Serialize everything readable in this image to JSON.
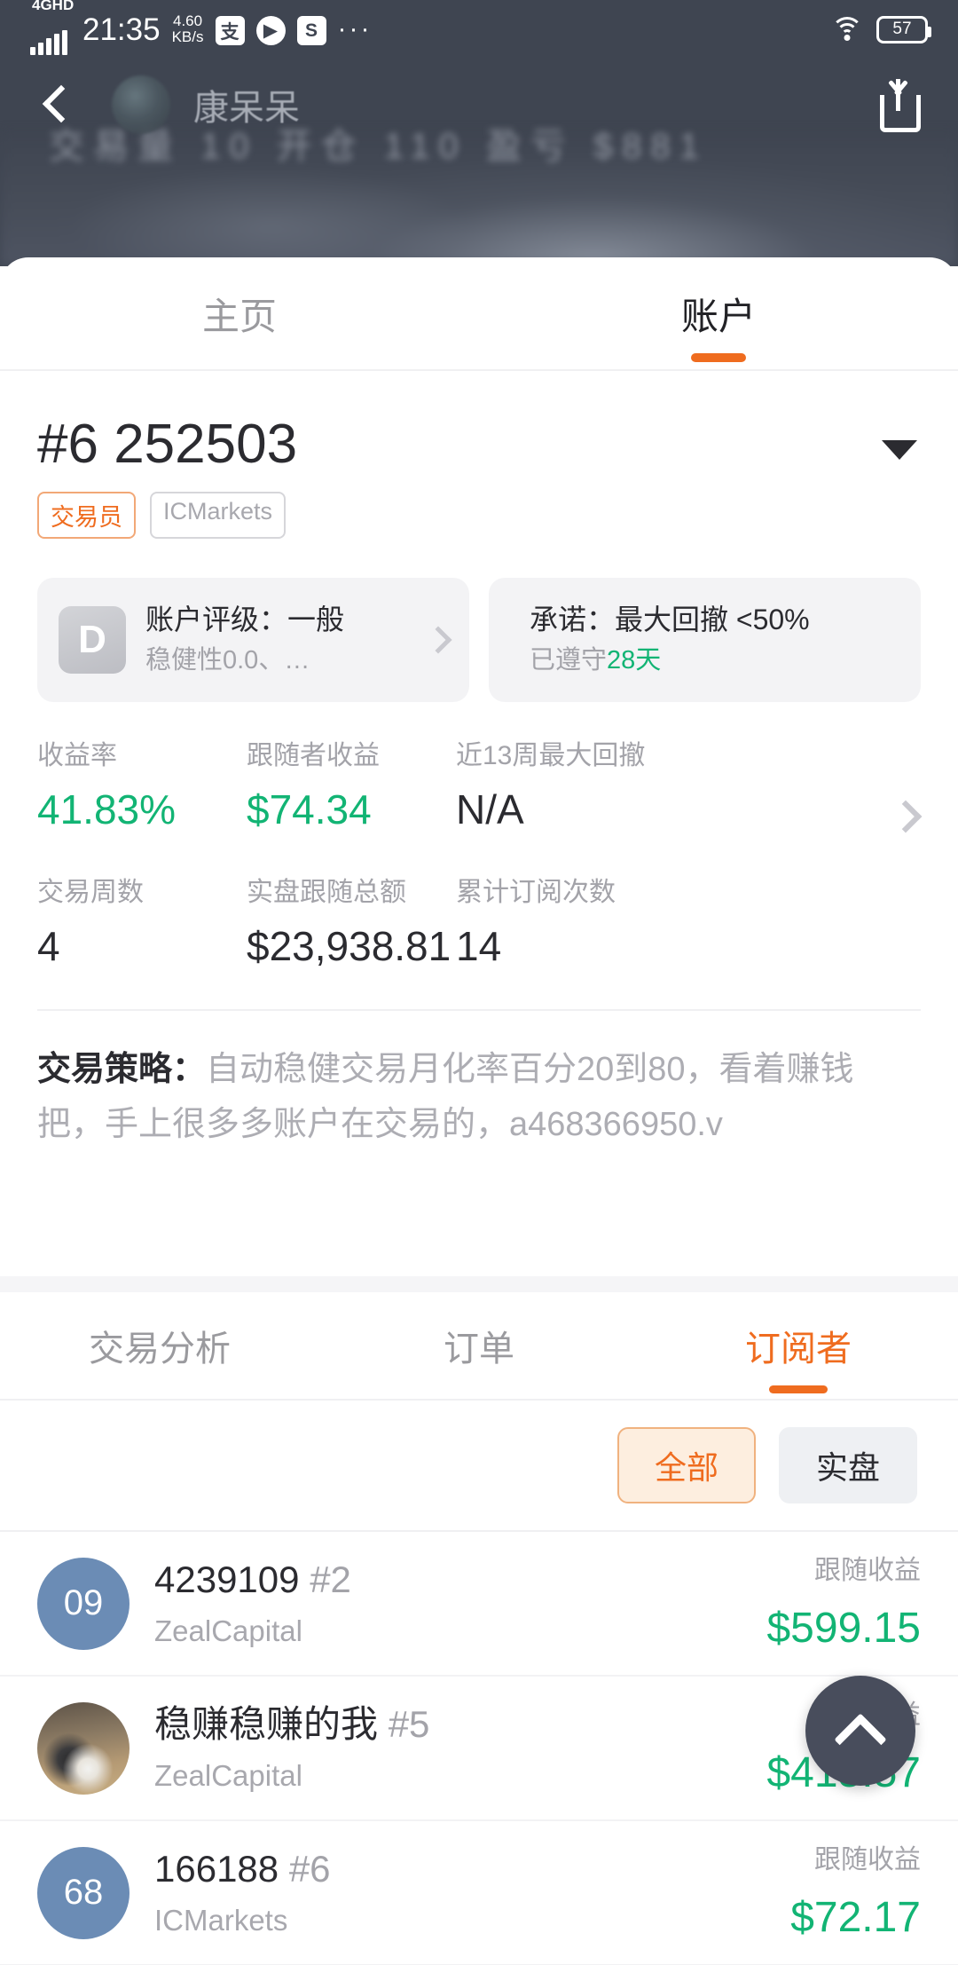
{
  "status_bar": {
    "network": "4GHD",
    "time": "21:35",
    "speed_value": "4.60",
    "speed_unit": "KB/s",
    "app_icon_1": "alipay-icon",
    "app_icon_2": "play-icon",
    "app_icon_3": "s-app-icon",
    "more": "···",
    "wifi": "wifi-icon",
    "battery": "57"
  },
  "nav": {
    "back": "back-arrow-icon",
    "avatar": "user-avatar",
    "username": "康呆呆",
    "share": "share-icon"
  },
  "hero": {
    "ghost_text": "交易量 10   开仓 110   盈亏 $881"
  },
  "top_tabs": [
    {
      "label": "主页",
      "active": false
    },
    {
      "label": "账户",
      "active": true
    }
  ],
  "account": {
    "id": "#6 252503",
    "caret": "chevron-down-icon",
    "badge_role": "交易员",
    "badge_broker": "ICMarkets"
  },
  "cards": {
    "rating": {
      "grade": "D",
      "line1": "账户评级：一般",
      "line2": "稳健性0.0、…",
      "chevron": "chevron-right-icon"
    },
    "promise": {
      "line1": "承诺：最大回撤 <50%",
      "line2_prefix": "已遵守",
      "line2_value": "28天"
    }
  },
  "stats": {
    "row1": [
      {
        "label": "收益率",
        "value": "41.83%",
        "color": "green"
      },
      {
        "label": "跟随者收益",
        "value": "$74.34",
        "color": "green"
      },
      {
        "label": "近13周最大回撤",
        "value": "N/A",
        "color": "dark"
      }
    ],
    "row2": [
      {
        "label": "交易周数",
        "value": "4",
        "color": "dark"
      },
      {
        "label": "实盘跟随总额",
        "value": "$23,938.81",
        "color": "dark"
      },
      {
        "label": "累计订阅次数",
        "value": "14",
        "color": "dark"
      }
    ],
    "chevron": "chevron-right-icon"
  },
  "strategy": {
    "label": "交易策略：",
    "text": "自动稳健交易月化率百分20到80，看着赚钱把，手上很多多账户在交易的，a468366950.v"
  },
  "sub_tabs": [
    {
      "label": "交易分析",
      "active": false
    },
    {
      "label": "订单",
      "active": false
    },
    {
      "label": "订阅者",
      "active": true
    }
  ],
  "filters": [
    {
      "label": "全部",
      "active": true
    },
    {
      "label": "实盘",
      "active": false
    }
  ],
  "subscribers": [
    {
      "avatar_text": "09",
      "avatar_type": "initials",
      "name": "4239109",
      "rank": "#2",
      "broker": "ZealCapital",
      "profit_label": "跟随收益",
      "profit_value": "$599.15"
    },
    {
      "avatar_text": "",
      "avatar_type": "photo",
      "name": "稳赚稳赚的我",
      "rank": "#5",
      "broker": "ZealCapital",
      "profit_label": "跟随收益",
      "profit_value": "$415.57"
    },
    {
      "avatar_text": "68",
      "avatar_type": "initials",
      "name": "166188",
      "rank": "#6",
      "broker": "ICMarkets",
      "profit_label": "跟随收益",
      "profit_value": "$72.17"
    }
  ],
  "fab": {
    "icon": "chevron-up-icon"
  },
  "colors": {
    "accent": "#ef6c1f",
    "green": "#12b474",
    "dark_header": "#3f4551",
    "avatar_blue": "#6b8cb5"
  }
}
